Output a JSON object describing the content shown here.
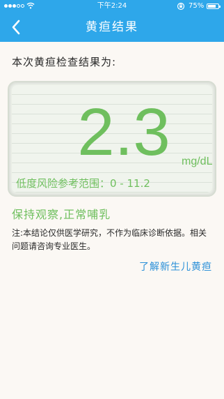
{
  "status_bar": {
    "time": "下午2:24",
    "battery": "75%",
    "battery_level": 0.75
  },
  "navbar": {
    "title": "黄疸结果"
  },
  "result": {
    "intro": "本次黄疸检查结果为:",
    "value": "2.3",
    "unit": "mg/dL",
    "range": "低度风险参考范围：0 - 11.2",
    "advice": "保持观察,正常哺乳",
    "note": "注:本结论仅供医学研究，不作为临床诊断依据。相关问题请咨询专业医生。",
    "learn_link": "了解新生儿黄疸"
  },
  "colors": {
    "header": "#2ea7ea",
    "result_green": "#6fbf5e",
    "link_blue": "#2a8fd8",
    "background": "#fbf8f4"
  },
  "icons": [
    "signal-icon",
    "wifi-icon",
    "orientation-lock-icon",
    "battery-icon",
    "back-chevron-icon"
  ]
}
